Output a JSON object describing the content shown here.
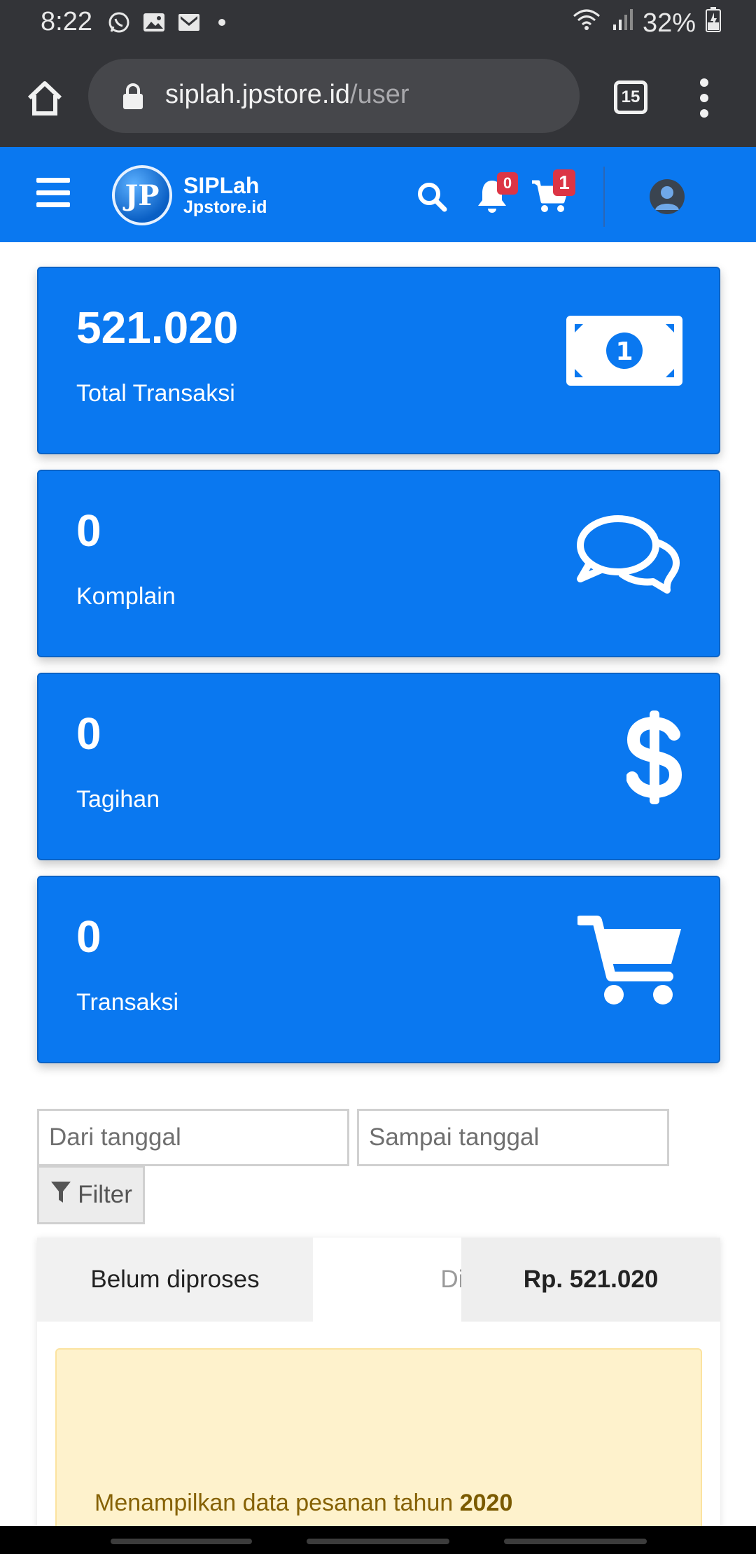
{
  "status_bar": {
    "time": "8:22",
    "battery": "32%"
  },
  "browser": {
    "url_host": "siplah.jpstore.id",
    "url_path": "/user",
    "tab_count": "15"
  },
  "header": {
    "logo_mark": "JP",
    "logo_title": "SIPLah",
    "logo_subtitle": "Jpstore.id",
    "notification_count": "0",
    "cart_count": "1"
  },
  "cards": [
    {
      "value": "521.020",
      "label": "Total Transaksi",
      "icon": "money-bill-icon"
    },
    {
      "value": "0",
      "label": "Komplain",
      "icon": "comments-icon"
    },
    {
      "value": "0",
      "label": "Tagihan",
      "icon": "dollar-sign-icon"
    },
    {
      "value": "0",
      "label": "Transaksi",
      "icon": "shopping-cart-icon"
    }
  ],
  "filters": {
    "from_placeholder": "Dari tanggal",
    "to_placeholder": "Sampai tanggal",
    "filter_label": "Filter"
  },
  "tabs": {
    "unprocessed": "Belum diproses",
    "processed": "Dipro",
    "total": "Rp. 521.020"
  },
  "notice": {
    "text": "Menampilkan data pesanan tahun ",
    "year": "2020"
  },
  "colors": {
    "primary": "#0a78f0",
    "badge": "#dc3545",
    "notice_bg": "#fef2cc"
  }
}
